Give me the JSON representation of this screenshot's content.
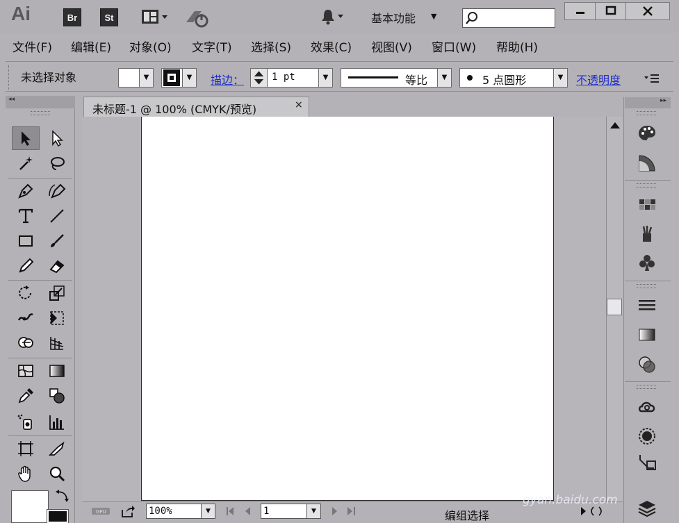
{
  "app": {
    "logo": "Ai",
    "bridge": "Br",
    "stock": "St",
    "workspace": "基本功能"
  },
  "menu": [
    "文件(F)",
    "编辑(E)",
    "对象(O)",
    "文字(T)",
    "选择(S)",
    "效果(C)",
    "视图(V)",
    "窗口(W)",
    "帮助(H)"
  ],
  "control": {
    "selection": "未选择对象",
    "stroke_label": "描边：",
    "stroke_value": "1 pt",
    "profile": "等比",
    "brush": "5 点圆形",
    "opacity": "不透明度"
  },
  "document": {
    "tab": "未标题-1 @ 100% (CMYK/预览)",
    "close": "×"
  },
  "status": {
    "zoom": "100%",
    "page": "1",
    "tool_status": "编组选择"
  },
  "watermark": "gyan.baidu.com",
  "colors": {
    "chrome": "#b4b2b6",
    "link": "#1f2dd0",
    "artboard": "#ffffff"
  }
}
